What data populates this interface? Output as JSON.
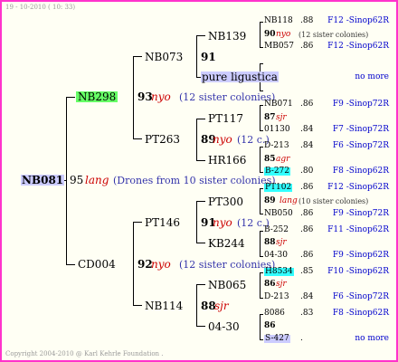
{
  "header": {
    "date": "19 - 10-2010 ( 10: 33)"
  },
  "footer": {
    "copyright": "Copyright 2004-2010 @ Karl Kehrle Foundation ."
  },
  "colors": {
    "frame": "#ff33cc",
    "background": "#fffff4",
    "queen_highlight": "#ccccff",
    "green_highlight": "#66ff66",
    "cyan_highlight": "#33ffff",
    "year_italic": "#cc0000",
    "sister_text": "#3333aa",
    "pedigree_link": "#0000cc"
  },
  "gen0": {
    "name": "NB081",
    "year": "95",
    "mark": "lang",
    "note": "(Drones from 10 sister colonies)"
  },
  "gen1": [
    {
      "name": "NB298",
      "year": "93",
      "mark": "nyo",
      "note": "(12 sister colonies)"
    },
    {
      "name": "CD004",
      "year": "92",
      "mark": "nyo",
      "note": "(12 sister colonies)"
    }
  ],
  "gen2": [
    {
      "name": "NB073",
      "year": "91"
    },
    {
      "name": "PT263",
      "year": "89",
      "mark": "nyo",
      "note": "(12 c.)"
    },
    {
      "name": "PT146",
      "year": "91",
      "mark": "nyo",
      "note": "(12 c.)"
    },
    {
      "name": "NB114",
      "year": "88",
      "mark": "sjr"
    }
  ],
  "gen3": [
    {
      "name": "NB139",
      "year": "90",
      "mark": "nyo",
      "note": "(12 sister colonies)"
    },
    {
      "name": "pure ligustica",
      "year": ""
    },
    {
      "name": "PT117",
      "year": "87",
      "mark": "sjr"
    },
    {
      "name": "HR166",
      "year": "85",
      "mark": "agr"
    },
    {
      "name": "PT300",
      "year": "89",
      "mark": "lang",
      "note": "(10 sister colonies)"
    },
    {
      "name": "KB244",
      "year": "88",
      "mark": "sjr"
    },
    {
      "name": "NB065",
      "year": "86",
      "mark": "sjr"
    },
    {
      "name": "04-30",
      "year": "86"
    }
  ],
  "gen4": [
    {
      "name": "NB118",
      "yr": ".88",
      "ped": "F12 -Sinop62R"
    },
    {
      "name": "MB057",
      "yr": ".86",
      "ped": "F12 -Sinop62R"
    },
    {
      "name": "",
      "yr": "",
      "ped": "no more"
    },
    {
      "name": "NB071",
      "yr": ".86",
      "ped": "F9 -Sinop72R"
    },
    {
      "name": "01130",
      "yr": ".84",
      "ped": "F7 -Sinop72R"
    },
    {
      "name": "D-213",
      "yr": ".84",
      "ped": "F6 -Sinop72R"
    },
    {
      "name": "B-272",
      "yr": ".80",
      "ped": "F8 -Sinop62R"
    },
    {
      "name": "PT102",
      "yr": ".86",
      "ped": "F12 -Sinop62R"
    },
    {
      "name": "NB050",
      "yr": ".86",
      "ped": "F9 -Sinop72R"
    },
    {
      "name": "B-252",
      "yr": ".86",
      "ped": "F11 -Sinop62R"
    },
    {
      "name": "04-30",
      "yr": ".86",
      "ped": "F9 -Sinop62R"
    },
    {
      "name": "H8534",
      "yr": ".85",
      "ped": "F10 -Sinop62R"
    },
    {
      "name": "D-213",
      "yr": ".84",
      "ped": "F6 -Sinop72R"
    },
    {
      "name": "8086",
      "yr": ".83",
      "ped": "F8 -Sinop62R"
    },
    {
      "name": "S-427",
      "yr": ".",
      "ped": "no more"
    }
  ]
}
